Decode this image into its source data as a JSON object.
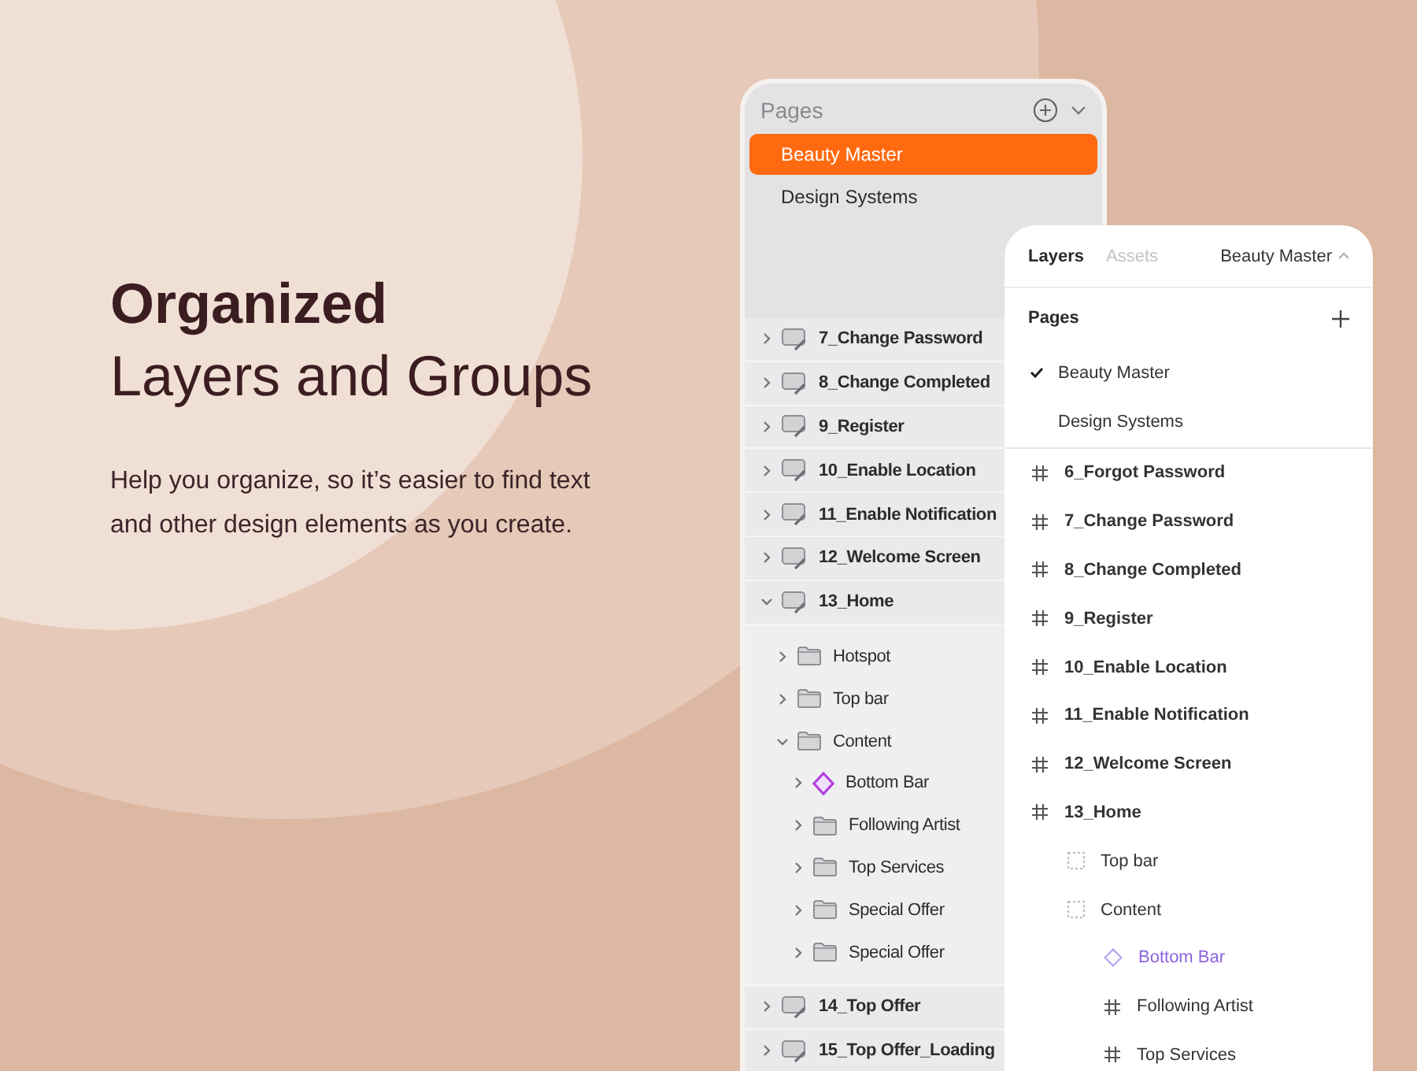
{
  "headline": {
    "title": "Organized",
    "subtitle": "Layers and Groups",
    "body": "Help you organize, so it’s easier to find text and other design elements as you create."
  },
  "pages_panel": {
    "title": "Pages",
    "pages": [
      {
        "label": "Beauty Master",
        "selected": true
      },
      {
        "label": "Design Systems",
        "selected": false
      }
    ],
    "layers": [
      {
        "kind": "frame",
        "label": "7_Change Password",
        "expanded": false
      },
      {
        "kind": "frame",
        "label": "8_Change Completed",
        "expanded": false
      },
      {
        "kind": "frame",
        "label": "9_Register",
        "expanded": false
      },
      {
        "kind": "frame",
        "label": "10_Enable Location",
        "expanded": false
      },
      {
        "kind": "frame",
        "label": "11_Enable Notification",
        "expanded": false
      },
      {
        "kind": "frame",
        "label": "12_Welcome Screen",
        "expanded": false
      },
      {
        "kind": "frame",
        "label": "13_Home",
        "expanded": true,
        "children": [
          {
            "kind": "folder",
            "label": "Hotspot",
            "expanded": false
          },
          {
            "kind": "folder",
            "label": "Top bar",
            "expanded": false
          },
          {
            "kind": "folder",
            "label": "Content",
            "expanded": true,
            "children": [
              {
                "kind": "symbol",
                "label": "Bottom Bar",
                "expanded": false
              },
              {
                "kind": "folder",
                "label": "Following Artist",
                "expanded": false
              },
              {
                "kind": "folder",
                "label": "Top Services",
                "expanded": false
              },
              {
                "kind": "folder",
                "label": "Special Offer",
                "expanded": false
              },
              {
                "kind": "folder",
                "label": "Special Offer",
                "expanded": false
              }
            ]
          }
        ]
      },
      {
        "kind": "frame",
        "label": "14_Top Offer",
        "expanded": false
      },
      {
        "kind": "frame",
        "label": "15_Top Offer_Loading",
        "expanded": false
      }
    ]
  },
  "layers_panel": {
    "tabs": [
      {
        "label": "Layers",
        "selected": true
      },
      {
        "label": "Assets",
        "selected": false
      }
    ],
    "page_menu": "Beauty Master",
    "pages_title": "Pages",
    "pages": [
      {
        "label": "Beauty Master",
        "selected": true
      },
      {
        "label": "Design Systems",
        "selected": false
      }
    ],
    "layers": [
      {
        "kind": "frame",
        "label": "6_Forgot Password"
      },
      {
        "kind": "frame",
        "label": "7_Change Password"
      },
      {
        "kind": "frame",
        "label": "8_Change Completed"
      },
      {
        "kind": "frame",
        "label": "9_Register"
      },
      {
        "kind": "frame",
        "label": "10_Enable Location"
      },
      {
        "kind": "frame",
        "label": "11_Enable Notification"
      },
      {
        "kind": "frame",
        "label": "12_Welcome Screen"
      },
      {
        "kind": "frame",
        "label": "13_Home",
        "children": [
          {
            "kind": "group",
            "label": "Top bar"
          },
          {
            "kind": "group",
            "label": "Content",
            "children": [
              {
                "kind": "symbol",
                "label": "Bottom Bar"
              },
              {
                "kind": "frame",
                "label": "Following Artist"
              },
              {
                "kind": "frame",
                "label": "Top Services"
              }
            ]
          }
        ]
      }
    ]
  }
}
